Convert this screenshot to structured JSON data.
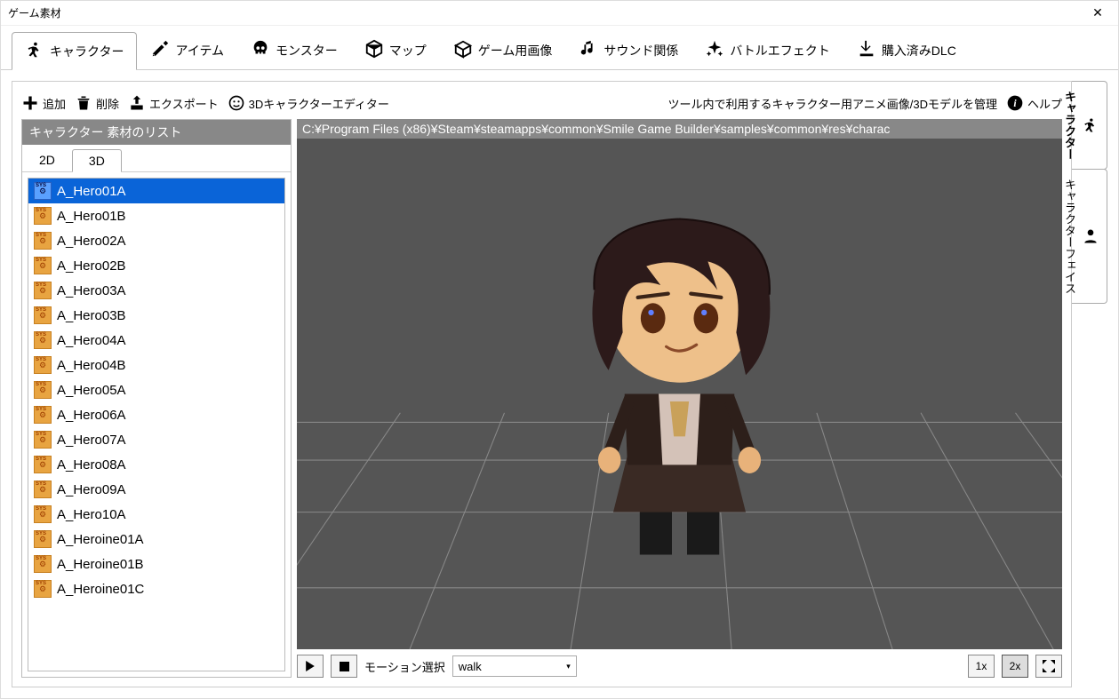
{
  "window": {
    "title": "ゲーム素材"
  },
  "main_tabs": [
    {
      "label": "キャラクター",
      "icon": "person-run",
      "active": true
    },
    {
      "label": "アイテム",
      "icon": "sword",
      "active": false
    },
    {
      "label": "モンスター",
      "icon": "skull",
      "active": false
    },
    {
      "label": "マップ",
      "icon": "cube",
      "active": false
    },
    {
      "label": "ゲーム用画像",
      "icon": "box",
      "active": false
    },
    {
      "label": "サウンド関係",
      "icon": "music",
      "active": false
    },
    {
      "label": "バトルエフェクト",
      "icon": "sparkle",
      "active": false
    },
    {
      "label": "購入済みDLC",
      "icon": "download",
      "active": false
    }
  ],
  "toolbar": {
    "add": "追加",
    "delete": "削除",
    "export": "エクスポート",
    "editor3d": "3Dキャラクターエディター",
    "manage_text": "ツール内で利用するキャラクター用アニメ画像/3Dモデルを管理",
    "help": "ヘルプ"
  },
  "list": {
    "header": "キャラクター 素材のリスト",
    "sub_tabs": [
      {
        "label": "2D",
        "active": false
      },
      {
        "label": "3D",
        "active": true
      }
    ],
    "items": [
      {
        "name": "A_Hero01A",
        "selected": true
      },
      {
        "name": "A_Hero01B"
      },
      {
        "name": "A_Hero02A"
      },
      {
        "name": "A_Hero02B"
      },
      {
        "name": "A_Hero03A"
      },
      {
        "name": "A_Hero03B"
      },
      {
        "name": "A_Hero04A"
      },
      {
        "name": "A_Hero04B"
      },
      {
        "name": "A_Hero05A"
      },
      {
        "name": "A_Hero06A"
      },
      {
        "name": "A_Hero07A"
      },
      {
        "name": "A_Hero08A"
      },
      {
        "name": "A_Hero09A"
      },
      {
        "name": "A_Hero10A"
      },
      {
        "name": "A_Heroine01A"
      },
      {
        "name": "A_Heroine01B"
      },
      {
        "name": "A_Heroine01C"
      }
    ]
  },
  "viewport": {
    "path": "C:¥Program Files (x86)¥Steam¥steamapps¥common¥Smile Game Builder¥samples¥common¥res¥charac"
  },
  "playback": {
    "motion_label": "モーション選択",
    "motion_value": "walk",
    "zoom_1x": "1x",
    "zoom_2x": "2x"
  },
  "right_tabs": [
    {
      "label": "キャラクター",
      "icon": "person-run",
      "active": true
    },
    {
      "label": "キャラクターフェイス",
      "icon": "person",
      "active": false
    }
  ]
}
